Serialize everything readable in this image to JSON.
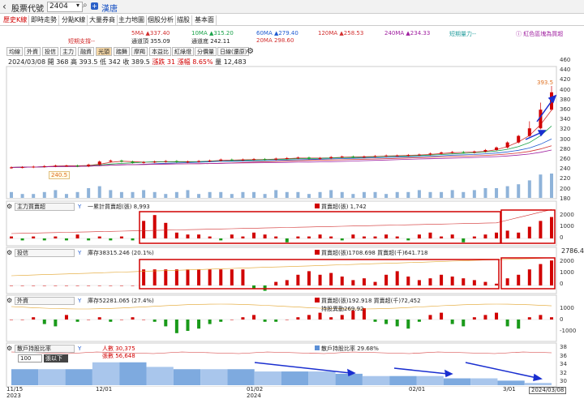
{
  "topbar": {
    "back_glyph": "‹",
    "title": "股票代號",
    "code": "2404",
    "dropdown": "▾",
    "search_glyph": "🔍",
    "plus_glyph": "+",
    "name": "漢唐"
  },
  "tabs": [
    "歷史K線",
    "即時走勢",
    "分點K線",
    "大量券商",
    "主力地圖",
    "個股分析",
    "描股",
    "基本面"
  ],
  "legend": {
    "ma5": "5MA ▲337.40",
    "ma10": "10MA ▲315.20",
    "ma60": "60MA ▲279.40",
    "ma120": "120MA ▲258.53",
    "ma240": "240MA ▲234.33",
    "short_power": "短期量力--",
    "short_support": "短期支撐--",
    "ch_top": "通道頂 355.09",
    "ch_bottom": "通道底 242.11",
    "ma20": "20MA 298.60",
    "notice": "ⓘ 紅色區塊為買超",
    "colors": {
      "ma5": "#d22f2f",
      "ma10": "#1aa34a",
      "ma60": "#1f5bd1",
      "ma120": "#d22f2f",
      "ma240": "#a020a0",
      "ma20": "#d22f2f",
      "short": "#2aa0a0"
    }
  },
  "toolbar": [
    "均線",
    "外資",
    "投信",
    "主力",
    "融資",
    "光頭",
    "踏舞",
    "摩羯",
    "本益比",
    "紅綠燈",
    "分價量",
    "日線(還原)"
  ],
  "info": {
    "date": "2024/03/08",
    "open": "開 368",
    "high": "高 393.5",
    "low": "低 342",
    "close": "收 389.5",
    "change": "漲跌 31",
    "pct": "漲幅 8.65%",
    "vol": "量 12,483"
  },
  "price_axis": [
    "460",
    "440",
    "420",
    "400",
    "380",
    "360",
    "340",
    "320",
    "300",
    "280",
    "260",
    "240",
    "220",
    "200",
    "180"
  ],
  "price_high_label": "393.5",
  "price_low_label": "240.5",
  "panels": {
    "main_force": {
      "select": "主力買賣超",
      "gear": "⚙",
      "y": "Y",
      "series_label": "一累計買賣超(張) 8,993",
      "daily_label": "買賣超(張) 1,742",
      "axis": [
        "2000",
        "1000",
        "0"
      ]
    },
    "trust": {
      "select": "投信",
      "y": "Y",
      "series_label": "庫存38315.246 (20.1%)",
      "daily_label": "買賣超(張)1708.698 買賣超(千)641.718",
      "axis": [
        "2000",
        "1000",
        "0"
      ],
      "side_value": "2786.4"
    },
    "foreign": {
      "select": "外資",
      "y": "Y",
      "series_label": "庫存52281.065 (27.4%)",
      "daily_label": "買賣超(張)192.918 買賣超(千)72,452",
      "daily_label2": "持股異動269.92",
      "axis": [
        "1000",
        "0",
        "-1000"
      ]
    },
    "holders": {
      "select": "散戶持股比率",
      "y": "Y",
      "people": "人數 30,375",
      "lots": "張數 56,648",
      "ratio": "散戶持股比率 29.68%",
      "filter": "100",
      "filter_option": "張以下",
      "axis": [
        "38",
        "36",
        "34",
        "32",
        "30"
      ]
    }
  },
  "dates": [
    {
      "label": "11/15"
    },
    {
      "label": "2023",
      "sub": true
    },
    {
      "label": "12/01"
    },
    {
      "label": "01/02"
    },
    {
      "label": "2024",
      "sub": true
    },
    {
      "label": "02/01"
    },
    {
      "label": "3/01"
    },
    {
      "label": "2024/03/08"
    }
  ],
  "chart_data": {
    "type": "bar",
    "price_close": [
      240.5,
      241,
      242,
      243,
      244,
      244,
      243,
      246,
      252,
      254,
      252,
      250,
      251,
      252,
      253,
      251,
      252,
      253,
      254,
      256,
      255,
      256,
      257,
      256,
      258,
      259,
      260,
      258,
      259,
      261,
      262,
      261,
      262,
      263,
      264,
      264,
      265,
      266,
      268,
      270,
      271,
      270,
      272,
      275,
      280,
      290,
      303,
      318,
      355,
      389.5
    ],
    "volume": [
      3,
      2,
      2,
      3,
      4,
      2,
      3,
      5,
      6,
      4,
      3,
      3,
      4,
      3,
      2,
      3,
      4,
      2,
      3,
      3,
      2,
      3,
      3,
      2,
      4,
      3,
      3,
      2,
      3,
      4,
      3,
      2,
      3,
      3,
      2,
      3,
      3,
      4,
      3,
      3,
      4,
      3,
      4,
      5,
      5,
      6,
      7,
      9,
      12,
      12.5
    ]
  }
}
